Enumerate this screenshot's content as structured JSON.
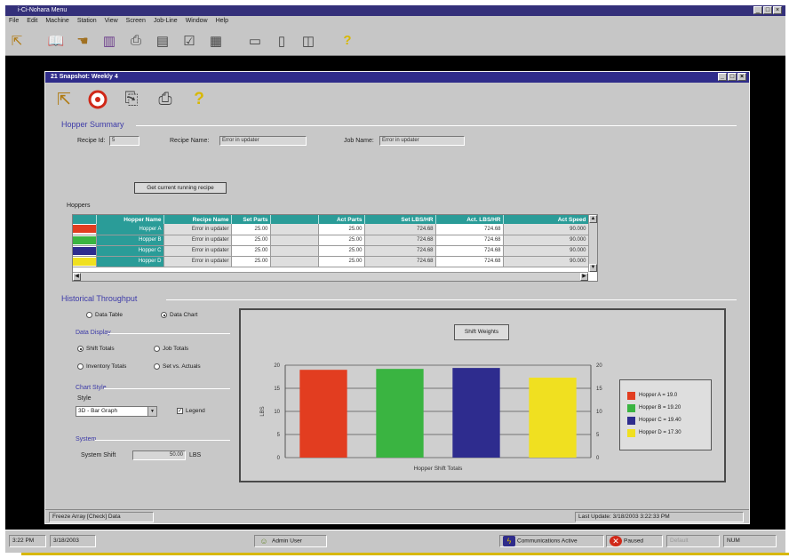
{
  "outer_window": {
    "title": "i-Ci-Nohara Menu",
    "menu": [
      "File",
      "Edit",
      "Machine",
      "Station",
      "View",
      "Screen",
      "Job-Line",
      "Window",
      "Help"
    ],
    "controls": [
      "_",
      "□",
      "×"
    ]
  },
  "inner_window": {
    "title": "21 Snapshot: Weekly 4",
    "controls": [
      "_",
      "□",
      "×"
    ]
  },
  "hopper_summary": {
    "group_label": "Hopper Summary",
    "recipe_id_label": "Recipe Id:",
    "recipe_id_value": "5",
    "recipe_name_label": "Recipe Name:",
    "recipe_name_value": "Error in updater",
    "job_name_label": "Job Name:",
    "job_name_value": "Error in updater",
    "action_button": "Get current running recipe",
    "hoppers_label": "Hoppers"
  },
  "grid": {
    "columns": [
      "",
      "Hopper Name",
      "Recipe Name",
      "Set Parts",
      "",
      "Act Parts",
      "Set LBS/HR",
      "Act. LBS/HR",
      "Act Speed"
    ],
    "rows": [
      {
        "color": "#e23d20",
        "name": "Hopper A",
        "recipe": "Error in updater",
        "set_parts": "25.00",
        "act_parts": "25.00",
        "set_lbs": "724.68",
        "act_lbs": "724.68",
        "speed": "90.000"
      },
      {
        "color": "#3ab441",
        "name": "Hopper B",
        "recipe": "Error in updater",
        "set_parts": "25.00",
        "act_parts": "25.00",
        "set_lbs": "724.68",
        "act_lbs": "724.68",
        "speed": "90.000"
      },
      {
        "color": "#2e2c8e",
        "name": "Hopper C",
        "recipe": "Error in updater",
        "set_parts": "25.00",
        "act_parts": "25.00",
        "set_lbs": "724.68",
        "act_lbs": "724.68",
        "speed": "90.000"
      },
      {
        "color": "#f0e020",
        "name": "Hopper D",
        "recipe": "Error in updater",
        "set_parts": "25.00",
        "act_parts": "25.00",
        "set_lbs": "724.68",
        "act_lbs": "724.68",
        "speed": "90.000"
      }
    ]
  },
  "throughput": {
    "group_label": "Historical Throughput",
    "radio_data_table": "Data Table",
    "radio_data_chart": "Data Chart",
    "data_display_label": "Data Display",
    "radio_shift_totals": "Shift Totals",
    "radio_job_totals": "Job Totals",
    "radio_inventory_totals": "Inventory Totals",
    "radio_set_vs_actuals": "Set vs. Actuals",
    "chart_style_label": "Chart Style",
    "style_label": "Style",
    "style_value": "3D - Bar Graph",
    "legend_check_label": "Legend",
    "legend_checked": "✓",
    "system_label": "System",
    "system_shift_label": "System Shift",
    "system_shift_value": "50.00",
    "system_shift_unit": "LBS"
  },
  "chart_data": {
    "type": "bar",
    "title": "Shift Weights",
    "categories": [
      "Hopper A",
      "Hopper B",
      "Hopper C",
      "Hopper D"
    ],
    "values": [
      19.0,
      19.2,
      19.4,
      17.3
    ],
    "colors": [
      "#e23d20",
      "#3ab441",
      "#2e2c8e",
      "#f0e020"
    ],
    "legend": [
      "Hopper A = 19.0",
      "Hopper B = 19.20",
      "Hopper C = 19.40",
      "Hopper D = 17.30"
    ],
    "xlabel": "Hopper Shift Totals",
    "ylabel": "LBS",
    "ylim": [
      0,
      20
    ],
    "yticks": [
      "0",
      "5",
      "10",
      "15",
      "20"
    ],
    "legend_position": "right",
    "grid": true
  },
  "inner_status": {
    "left": "Freeze Array [Check] Data",
    "right": "Last Update: 3/18/2003 3:22:33 PM"
  },
  "taskbar": {
    "time": "3:22 PM",
    "date": "3/18/2003",
    "admin": "Admin User",
    "comms": "Communications Active",
    "paused": "Paused",
    "pane": "Default",
    "num": "NUM"
  }
}
